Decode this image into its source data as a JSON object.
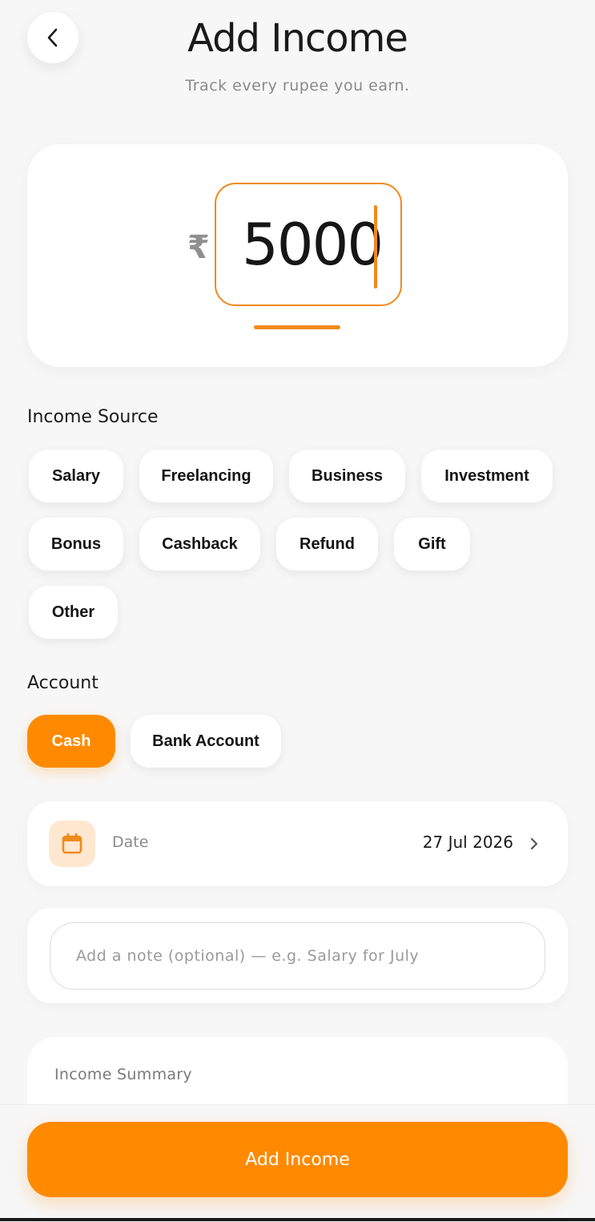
{
  "header": {
    "back_icon": "chevron-left-icon",
    "title": "Add Income",
    "subtitle": "Track every rupee you earn."
  },
  "amount": {
    "currency_symbol": "₹",
    "value": "5000",
    "accent_color": "#f08a1c"
  },
  "income_source": {
    "label": "Income Source",
    "options": [
      "Salary",
      "Freelancing",
      "Business",
      "Investment",
      "Bonus",
      "Cashback",
      "Refund",
      "Gift",
      "Other"
    ]
  },
  "account": {
    "label": "Account",
    "options": [
      "Cash",
      "Bank Account"
    ],
    "selected": "Cash",
    "selected_color": "#ff8a00"
  },
  "date": {
    "icon": "calendar-icon",
    "label": "Date",
    "value": "27 Jul 2026",
    "chevron_icon": "chevron-right-icon"
  },
  "note": {
    "placeholder": "Add a note (optional) — e.g. Salary for July",
    "value": ""
  },
  "summary": {
    "title": "Income Summary"
  },
  "footer": {
    "submit_label": "Add Income",
    "button_color": "#ff8a00"
  }
}
